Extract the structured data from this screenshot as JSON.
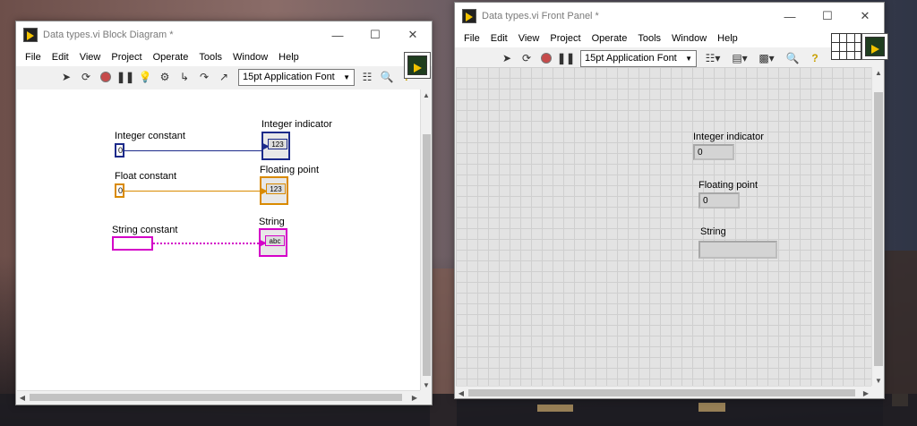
{
  "block_diagram": {
    "title": "Data types.vi Block Diagram *",
    "menu": [
      "File",
      "Edit",
      "View",
      "Project",
      "Operate",
      "Tools",
      "Window",
      "Help"
    ],
    "font": "15pt Application Font",
    "nodes": {
      "int_const_label": "Integer constant",
      "int_const_value": "0",
      "float_const_label": "Float constant",
      "float_const_value": "0",
      "string_const_label": "String constant",
      "int_ind_label": "Integer indicator",
      "int_ind_glyph": "123",
      "float_ind_label": "Floating point",
      "float_ind_glyph": "123",
      "string_ind_label": "String",
      "string_ind_glyph": "abc"
    }
  },
  "front_panel": {
    "title": "Data types.vi Front Panel *",
    "menu": [
      "File",
      "Edit",
      "View",
      "Project",
      "Operate",
      "Tools",
      "Window",
      "Help"
    ],
    "font": "15pt Application Font",
    "indicators": {
      "int_label": "Integer indicator",
      "int_value": "0",
      "float_label": "Floating point",
      "float_value": "0",
      "string_label": "String",
      "string_value": ""
    }
  },
  "colors": {
    "integer_wire": "#1c2a8a",
    "float_wire": "#d98a00",
    "string_wire": "#d400c8"
  },
  "icons": {
    "run": "run-arrow-icon",
    "run_continuous": "run-continuously-icon",
    "abort": "abort-icon",
    "pause": "pause-icon",
    "highlight": "highlight-execution-icon",
    "retain_wires": "retain-wire-values-icon",
    "step_into": "step-into-icon",
    "step_over": "step-over-icon",
    "step_out": "step-out-icon",
    "align": "align-objects-icon",
    "search": "search-icon",
    "help": "help-icon"
  }
}
